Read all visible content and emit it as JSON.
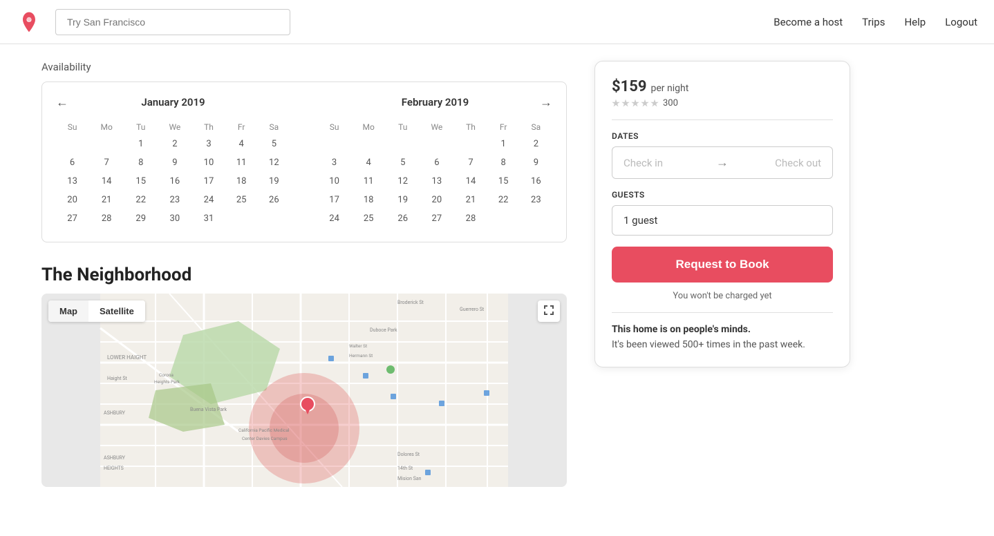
{
  "header": {
    "search_placeholder": "Try San Francisco",
    "nav": {
      "become_host": "Become a host",
      "trips": "Trips",
      "help": "Help",
      "logout": "Logout"
    }
  },
  "availability": {
    "label": "Availability",
    "calendar_jan": {
      "title": "January 2019",
      "days": [
        "Su",
        "Mo",
        "Tu",
        "We",
        "Th",
        "Fr",
        "Sa"
      ],
      "weeks": [
        [
          "",
          "",
          "1",
          "2",
          "3",
          "4",
          "5"
        ],
        [
          "6",
          "7",
          "8",
          "9",
          "10",
          "11",
          "12"
        ],
        [
          "13",
          "14",
          "15",
          "16",
          "17",
          "18",
          "19"
        ],
        [
          "20",
          "21",
          "22",
          "23",
          "24",
          "25",
          "26"
        ],
        [
          "27",
          "28",
          "29",
          "30",
          "31",
          "",
          ""
        ]
      ]
    },
    "calendar_feb": {
      "title": "February 2019",
      "days": [
        "Su",
        "Mo",
        "Tu",
        "We",
        "Th",
        "Fr",
        "Sa"
      ],
      "weeks": [
        [
          "",
          "",
          "",
          "",
          "",
          "1",
          "2"
        ],
        [
          "3",
          "4",
          "5",
          "6",
          "7",
          "8",
          "9"
        ],
        [
          "10",
          "11",
          "12",
          "13",
          "14",
          "15",
          "16"
        ],
        [
          "17",
          "18",
          "19",
          "20",
          "21",
          "22",
          "23"
        ],
        [
          "24",
          "25",
          "26",
          "27",
          "28",
          "",
          ""
        ]
      ]
    }
  },
  "neighborhood": {
    "title": "The Neighborhood",
    "map_button_map": "Map",
    "map_button_satellite": "Satellite"
  },
  "booking_card": {
    "price": "$159",
    "per_night": "per night",
    "rating_count": "300",
    "dates_label": "Dates",
    "check_in_placeholder": "Check in",
    "check_out_placeholder": "Check out",
    "guests_label": "Guests",
    "guests_value": "1 guest",
    "book_button_label": "Request to Book",
    "no_charge_text": "You won't be charged yet",
    "minds_title": "This home is on people's minds.",
    "minds_desc": "It's been viewed 500+ times in the past week."
  }
}
